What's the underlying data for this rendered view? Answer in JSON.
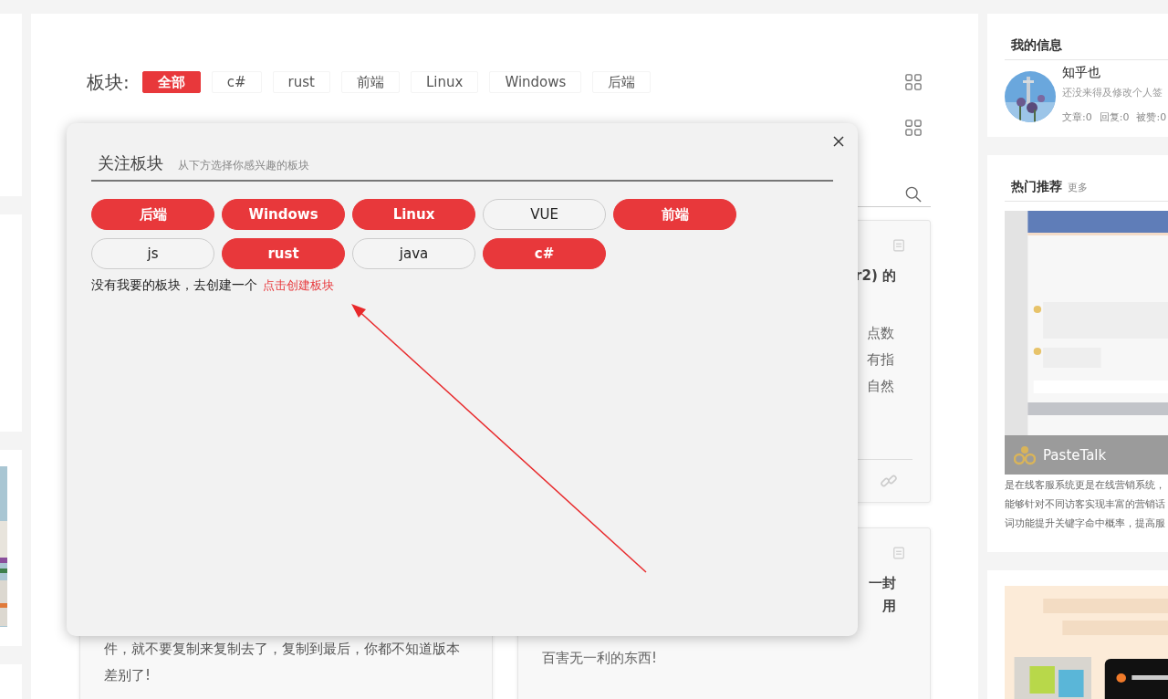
{
  "filter_bar": {
    "label": "板块:",
    "tags": [
      {
        "label": "全部",
        "selected": true
      },
      {
        "label": "c#",
        "selected": false
      },
      {
        "label": "rust",
        "selected": false
      },
      {
        "label": "前端",
        "selected": false
      },
      {
        "label": "Linux",
        "selected": false
      },
      {
        "label": "Windows",
        "selected": false
      },
      {
        "label": "后端",
        "selected": false
      }
    ]
  },
  "cards": [
    {
      "title_lines": [
        "r2) 的"
      ],
      "text_lines": [
        "点数",
        "有指",
        "自然"
      ],
      "has_footer": true
    },
    {
      "title_lines": [
        "一封",
        "用"
      ],
      "text_lines": [
        "百害无一利的东西!"
      ],
      "has_footer": false
    }
  ],
  "left_card_text": "件，就不要复制来复制去了，复制到最后，你都不知道版本差别了!",
  "sidebar": {
    "my_info": {
      "title": "我的信息",
      "name": "知乎也",
      "signature": "还没来得及修改个人签",
      "stats": [
        "文章:0",
        "回复:0",
        "被赞:0"
      ]
    },
    "hot": {
      "title": "热门推荐",
      "more": "更多",
      "caption": "PasteTalk",
      "description": [
        "是在线客服系统更是在线营销系统，",
        "能够针对不同访客实现丰富的营销话",
        "词功能提升关键字命中概率，提高服"
      ]
    }
  },
  "modal": {
    "title": "关注板块",
    "hint": "从下方选择你感兴趣的板块",
    "chips": [
      {
        "label": "后端",
        "selected": true
      },
      {
        "label": "Windows",
        "selected": true
      },
      {
        "label": "Linux",
        "selected": true
      },
      {
        "label": "VUE",
        "selected": false
      },
      {
        "label": "前端",
        "selected": true
      },
      {
        "label": "js",
        "selected": false
      },
      {
        "label": "rust",
        "selected": true
      },
      {
        "label": "java",
        "selected": false
      },
      {
        "label": "c#",
        "selected": true
      }
    ],
    "note": "没有我要的板块，去创建一个",
    "create_link": "点击创建板块"
  }
}
